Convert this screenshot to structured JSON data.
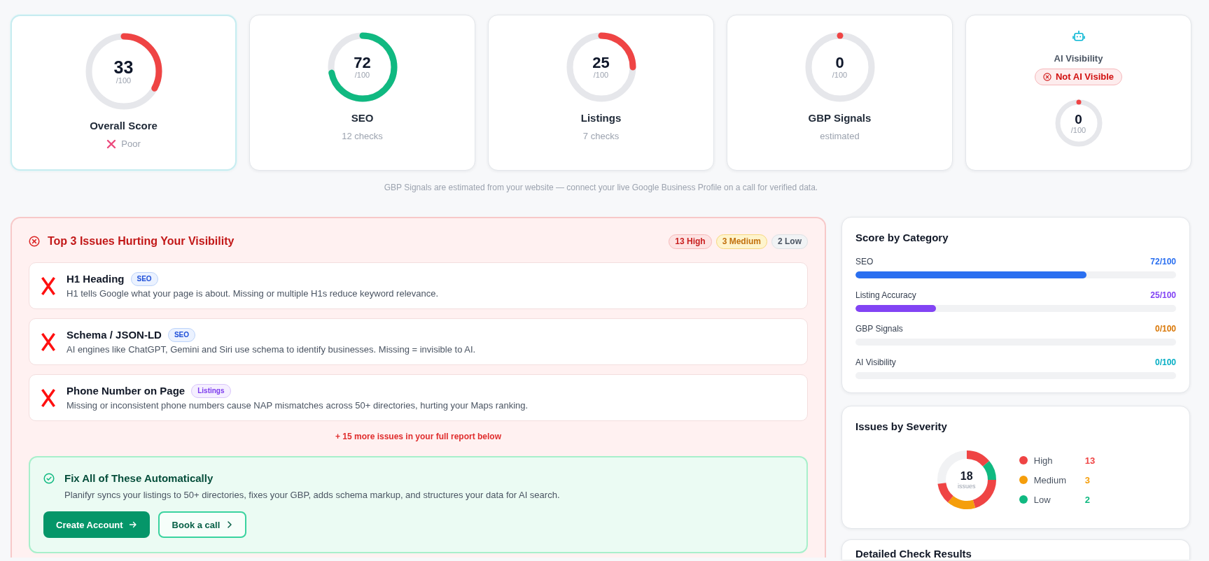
{
  "score_cards": [
    {
      "kind": "overall",
      "highlighted": true,
      "score": "33",
      "out_of": "/100",
      "level": 0.33,
      "title": "Overall Score",
      "status": "Poor"
    },
    {
      "kind": "category",
      "highlighted": false,
      "score": "72",
      "out_of": "/100",
      "level": 0.72,
      "title": "SEO",
      "subtitle": "12 checks"
    },
    {
      "kind": "category",
      "highlighted": false,
      "score": "25",
      "out_of": "/100",
      "level": 0.25,
      "title": "Listings",
      "subtitle": "7 checks"
    },
    {
      "kind": "category",
      "highlighted": false,
      "score": "0",
      "out_of": "/100",
      "level": 0,
      "title": "GBP Signals",
      "subtitle": "estimated"
    },
    {
      "kind": "ai",
      "highlighted": false,
      "title": "AI Visibility",
      "badge": "Not AI Visible",
      "score": "0",
      "out_of": "/100",
      "level": 0
    }
  ],
  "footnote": "GBP Signals are estimated from your website — connect your live Google Business Profile on a call for verified data.",
  "issues_panel": {
    "title": "Top 3 Issues Hurting Your Visibility",
    "counts": [
      {
        "kind": "high",
        "label": "13 High"
      },
      {
        "kind": "medium",
        "label": "3 Medium"
      },
      {
        "kind": "low",
        "label": "2 Low"
      }
    ],
    "issues": [
      {
        "title": "H1 Heading",
        "tag": {
          "kind": "seo",
          "label": "SEO"
        },
        "description": "H1 tells Google what your page is about. Missing or multiple H1s reduce keyword relevance."
      },
      {
        "title": "Schema / JSON-LD",
        "tag": {
          "kind": "seo",
          "label": "SEO"
        },
        "description": "AI engines like ChatGPT, Gemini and Siri use schema to identify businesses. Missing = invisible to AI."
      },
      {
        "title": "Phone Number on Page",
        "tag": {
          "kind": "listings",
          "label": "Listings"
        },
        "description": "Missing or inconsistent phone numbers cause NAP mismatches across 50+ directories, hurting your Maps ranking."
      }
    ],
    "more": "+ 15 more issues in your full report below",
    "cta": {
      "title": "Fix All of These Automatically",
      "description": "Planifyr syncs your listings to 50+ directories, fixes your GBP, adds schema markup, and structures your data for AI search.",
      "buttons": [
        {
          "kind": "primary",
          "label": "Create Account"
        },
        {
          "kind": "secondary",
          "label": "Book a call"
        }
      ]
    }
  },
  "score_by_category": {
    "title": "Score by Category",
    "rows": [
      {
        "label": "SEO",
        "value": "72/100",
        "level": 0.72,
        "color": "#2a6ff0"
      },
      {
        "label": "Listing Accuracy",
        "value": "25/100",
        "level": 0.25,
        "color": "#8244f4"
      },
      {
        "label": "GBP Signals",
        "value": "0/100",
        "level": 0,
        "color": "#d97706"
      },
      {
        "label": "AI Visibility",
        "value": "0/100",
        "level": 0,
        "color": "#06aec4"
      }
    ]
  },
  "issues_by_severity": {
    "title": "Issues by Severity",
    "total": "18",
    "total_label": "issues",
    "legend": [
      {
        "label": "High",
        "count": "13",
        "color": "#ef4444"
      },
      {
        "label": "Medium",
        "count": "3",
        "color": "#f59e0b"
      },
      {
        "label": "Low",
        "count": "2",
        "color": "#10b981"
      }
    ]
  },
  "detailed_results": {
    "title": "Detailed Check Results"
  }
}
